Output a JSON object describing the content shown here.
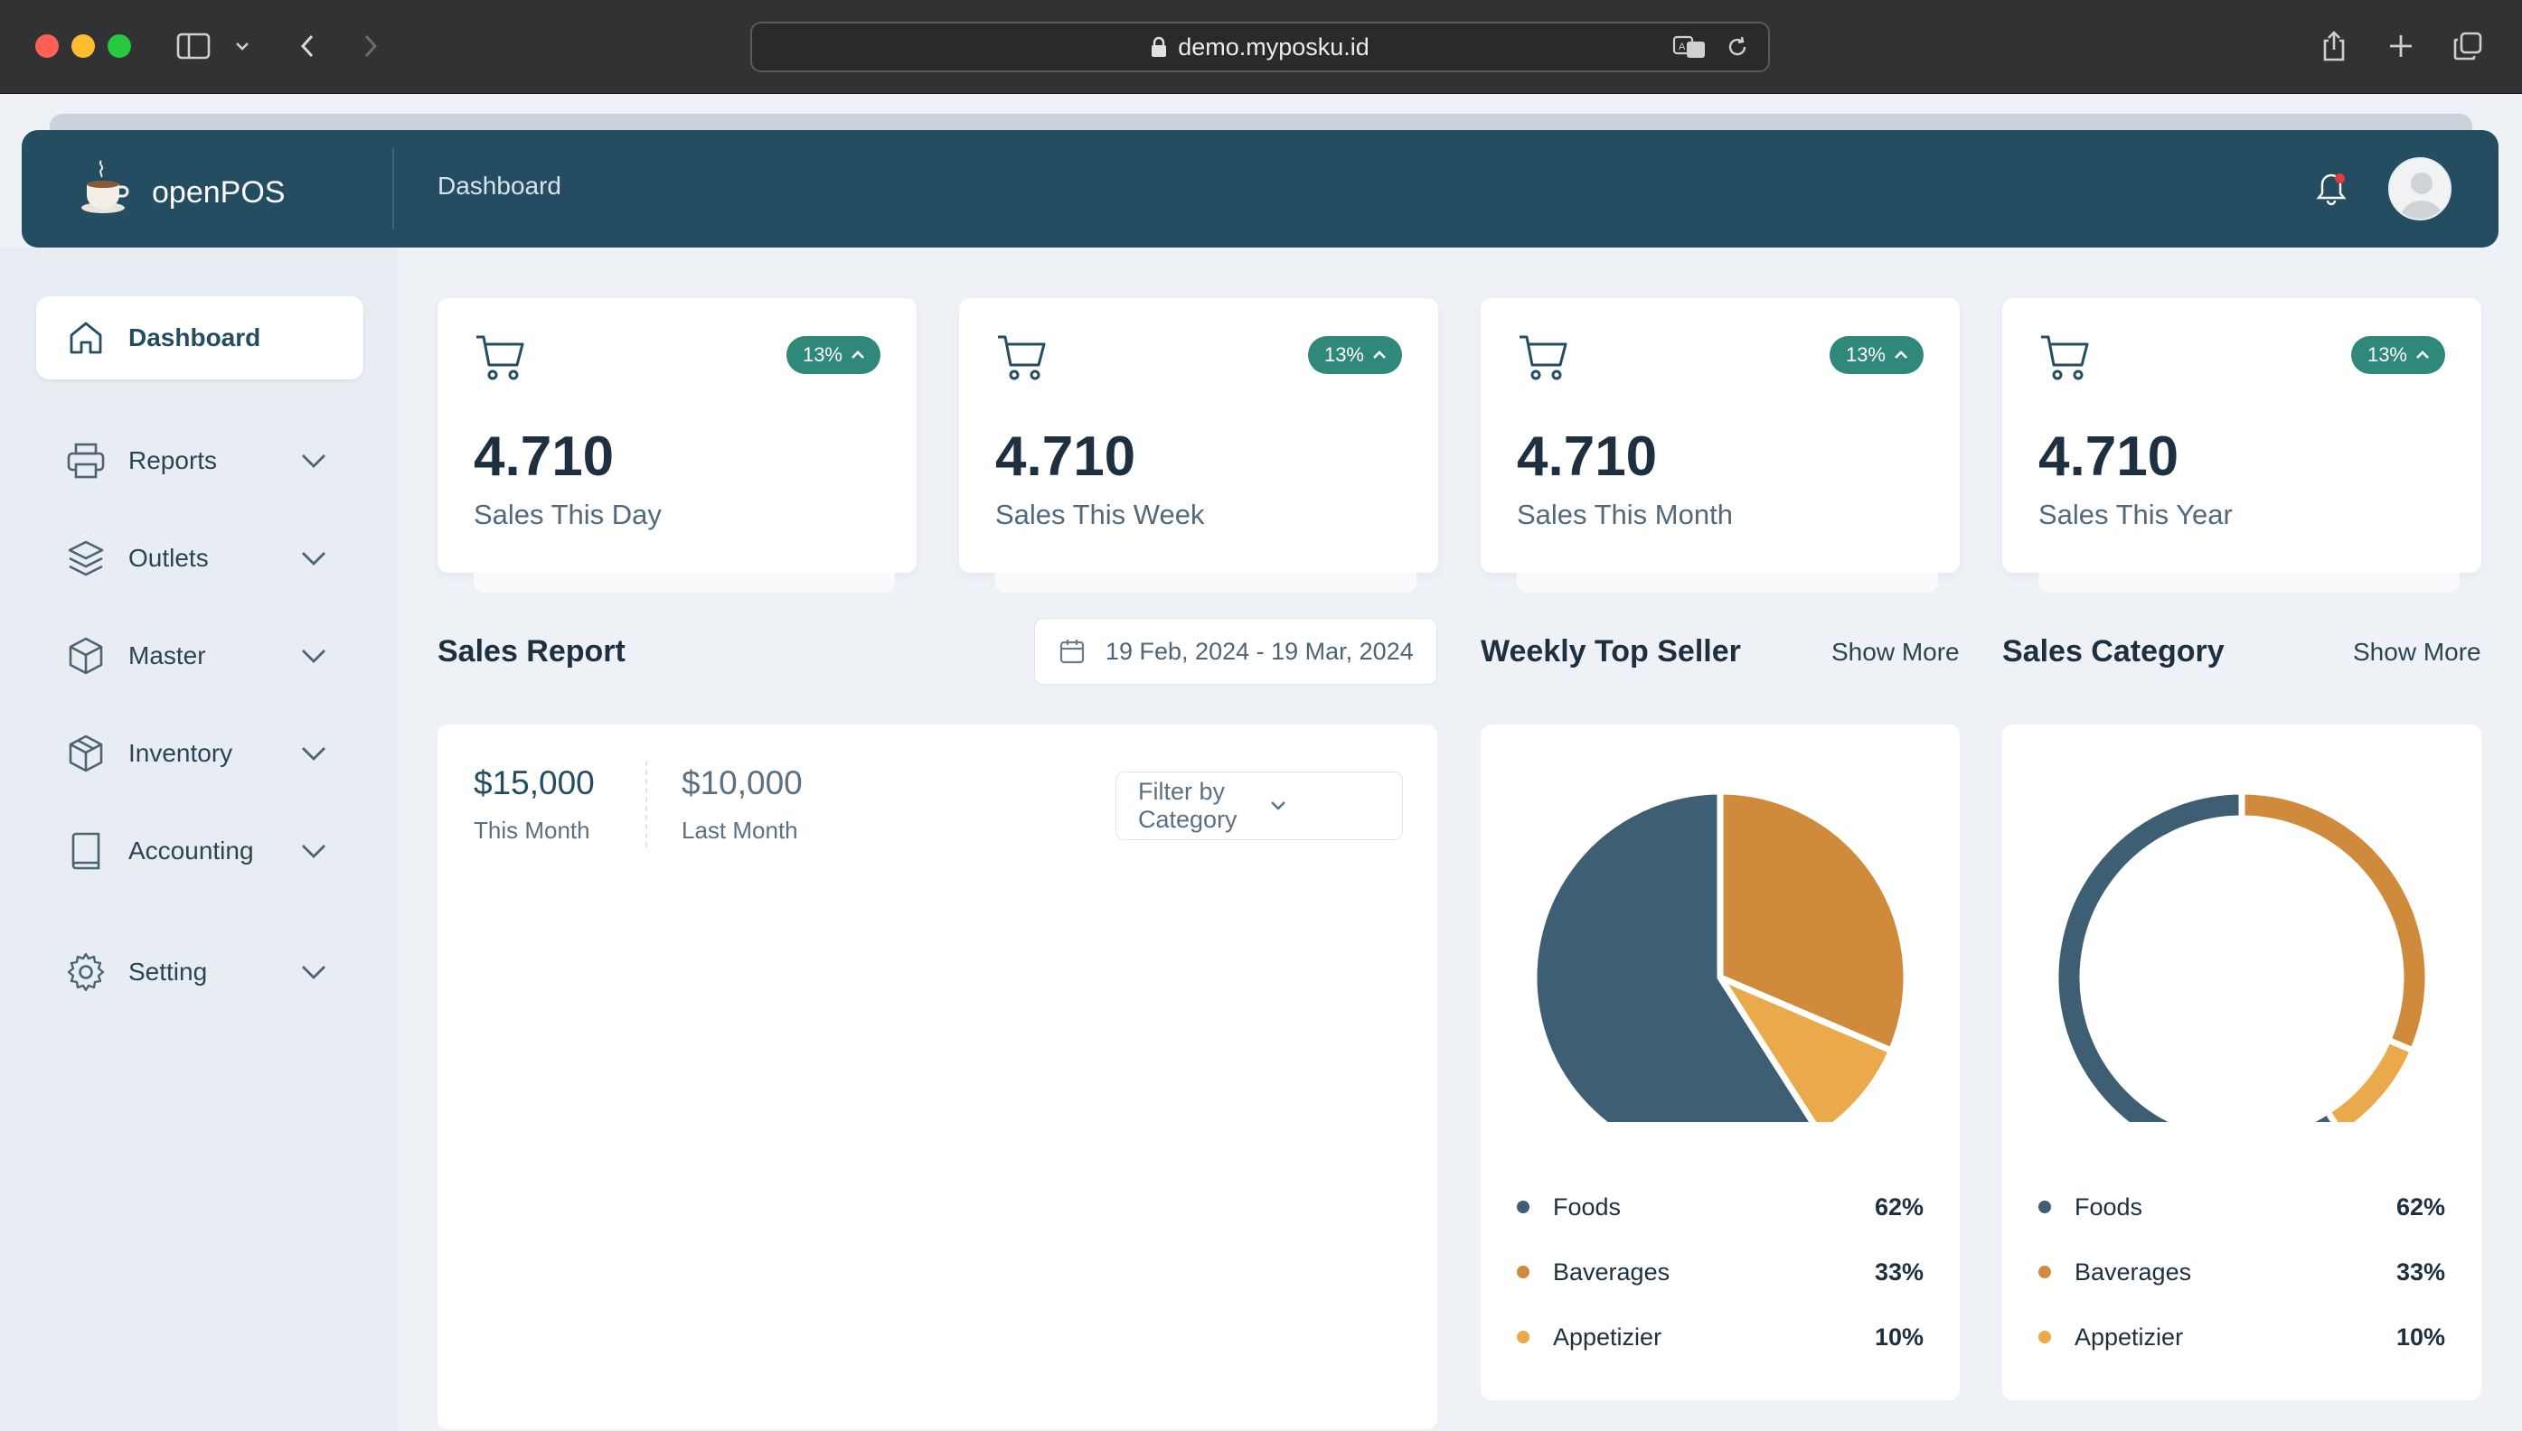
{
  "browser": {
    "url": "demo.myposku.id"
  },
  "app": {
    "brand": "openPOS",
    "page_title": "Dashboard"
  },
  "sidebar": {
    "items": [
      {
        "label": "Dashboard",
        "icon": "home-icon",
        "active": true
      },
      {
        "label": "Reports",
        "icon": "printer-icon"
      },
      {
        "label": "Outlets",
        "icon": "layers-icon"
      },
      {
        "label": "Master",
        "icon": "cube-icon"
      },
      {
        "label": "Inventory",
        "icon": "package-icon"
      },
      {
        "label": "Accounting",
        "icon": "book-icon"
      },
      {
        "label": "Setting",
        "icon": "gear-icon"
      }
    ]
  },
  "stats": [
    {
      "value": "4.710",
      "label": "Sales This Day",
      "badge": "13%"
    },
    {
      "value": "4.710",
      "label": "Sales This Week",
      "badge": "13%"
    },
    {
      "value": "4.710",
      "label": "Sales This Month",
      "badge": "13%"
    },
    {
      "value": "4.710",
      "label": "Sales This Year",
      "badge": "13%"
    }
  ],
  "sales_report": {
    "title": "Sales Report",
    "date_range": "19 Feb, 2024 - 19 Mar, 2024",
    "this_month_value": "$15,000",
    "this_month_label": "This Month",
    "last_month_value": "$10,000",
    "last_month_label": "Last Month",
    "filter_label": "Filter by Category"
  },
  "weekly_top_seller": {
    "title": "Weekly Top Seller",
    "show_more": "Show More"
  },
  "sales_category": {
    "title": "Sales Category",
    "show_more": "Show More"
  },
  "legend": [
    {
      "label": "Foods",
      "pct": "62%",
      "color": "#3d5e73"
    },
    {
      "label": "Baverages",
      "pct": "33%",
      "color": "#d08a3c"
    },
    {
      "label": "Appetizier",
      "pct": "10%",
      "color": "#eaa94a"
    }
  ],
  "chart_data": [
    {
      "type": "pie",
      "categories": [
        "Foods",
        "Baverages",
        "Appetizier"
      ],
      "values": [
        62,
        33,
        10
      ]
    },
    {
      "type": "pie",
      "style": "donut",
      "categories": [
        "Foods",
        "Baverages",
        "Appetizier"
      ],
      "values": [
        62,
        33,
        10
      ]
    }
  ]
}
